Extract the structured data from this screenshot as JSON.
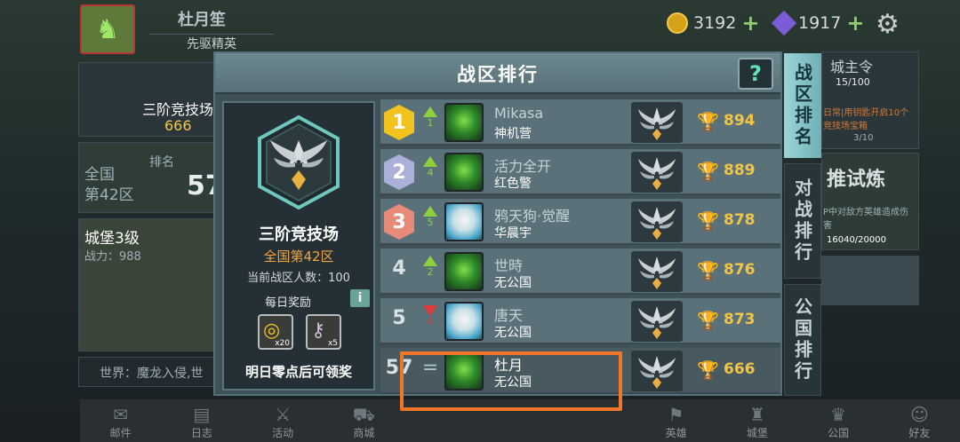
{
  "header": {
    "player_name": "杜月笙",
    "player_title": "先驱精英",
    "gold": "3192",
    "gems": "1917"
  },
  "background": {
    "arena_label": "三阶竞技场",
    "arena_score": "666",
    "region_line1": "全国",
    "region_line2": "第42区",
    "rank_label": "排名",
    "rank_partial": "57",
    "castle_level": "城堡3级",
    "power": "战力：988",
    "chat_line": "世界：魔龙入侵,世",
    "city_lord": "城主令",
    "city_lord_count": "15/100",
    "daily_note": "日常|用钥匙开启10个竞技场宝箱",
    "daily_progress": "3/10",
    "trial": "推试炼",
    "trial_note": "P中对敌方英雄造成伤害",
    "trial_progress": "16040/20000"
  },
  "bottom_nav": [
    "邮件",
    "日志",
    "活动",
    "商城",
    "英雄",
    "城堡",
    "公国",
    "好友"
  ],
  "modal": {
    "title": "战区排行",
    "help_label": "?",
    "arena_name": "三阶竞技场",
    "arena_zone": "全国第42区",
    "zone_count": "当前战区人数：100",
    "daily_reward_title": "每日奖励",
    "info_label": "i",
    "rewards": [
      {
        "name": "gold-coins",
        "qty": "x20"
      },
      {
        "name": "key",
        "qty": "x5"
      }
    ],
    "claim_note": "明日零点后可领奖"
  },
  "rankings": [
    {
      "rank": "1",
      "trend": "up",
      "change": "1",
      "name": "Mikasa",
      "guild": "神机营",
      "score": "894",
      "avatar": "green"
    },
    {
      "rank": "2",
      "trend": "up",
      "change": "4",
      "name": "活力全开",
      "guild": "红色警",
      "score": "889",
      "avatar": "green"
    },
    {
      "rank": "3",
      "trend": "up",
      "change": "5",
      "name": "鸦天狗·觉醒",
      "guild": "华晨宇",
      "score": "878",
      "avatar": "dog"
    },
    {
      "rank": "4",
      "trend": "up",
      "change": "2",
      "name": "世時",
      "guild": "无公国",
      "score": "876",
      "avatar": "green"
    },
    {
      "rank": "5",
      "trend": "down",
      "change": "4",
      "name": "唐天",
      "guild": "无公国",
      "score": "873",
      "avatar": "dog"
    },
    {
      "rank": "57",
      "trend": "equal",
      "change": "",
      "name": "杜月",
      "guild": "无公国",
      "score": "666",
      "avatar": "green"
    }
  ],
  "side_tabs": [
    "战区排名",
    "对战排行",
    "公国排行"
  ],
  "colors": {
    "gold_badge": "#f2c21e",
    "silver_badge": "#aab0d8",
    "bronze_badge": "#e88a7a",
    "trend_up": "#8cd23a",
    "trend_down": "#e23a3a",
    "score": "#f4c542",
    "highlight": "#f2762a"
  }
}
